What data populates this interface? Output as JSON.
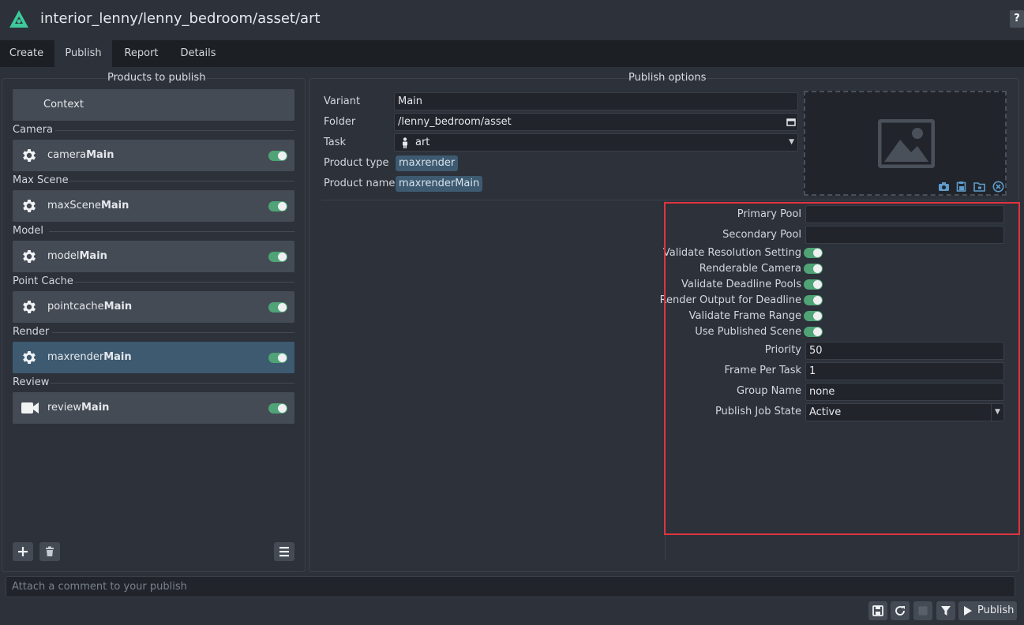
{
  "header": {
    "title": "interior_lenny/lenny_bedroom/asset/art",
    "help_label": "?"
  },
  "tabs": [
    {
      "label": "Create"
    },
    {
      "label": "Publish"
    },
    {
      "label": "Report"
    },
    {
      "label": "Details"
    }
  ],
  "left_panel": {
    "title": "Products to publish",
    "context_label": "Context",
    "groups": [
      {
        "label": "Camera",
        "product_prefix": "camera",
        "product_suffix": "Main",
        "icon": "gear-icon"
      },
      {
        "label": "Max Scene",
        "product_prefix": "maxScene",
        "product_suffix": "Main",
        "icon": "gear-icon"
      },
      {
        "label": "Model",
        "product_prefix": "model",
        "product_suffix": "Main",
        "icon": "gear-icon"
      },
      {
        "label": "Point Cache",
        "product_prefix": "pointcache",
        "product_suffix": "Main",
        "icon": "gear-icon"
      },
      {
        "label": "Render",
        "product_prefix": "maxrender",
        "product_suffix": "Main",
        "icon": "gear-icon",
        "selected": true
      },
      {
        "label": "Review",
        "product_prefix": "review",
        "product_suffix": "Main",
        "icon": "video-camera-icon"
      }
    ]
  },
  "right_panel": {
    "title": "Publish options",
    "variant": {
      "label": "Variant",
      "value": "Main"
    },
    "folder": {
      "label": "Folder",
      "value": "/lenny_bedroom/asset"
    },
    "task": {
      "label": "Task",
      "value": "art"
    },
    "product_type": {
      "label": "Product type",
      "value": "maxrender"
    },
    "product_name": {
      "label": "Product name",
      "value": "maxrenderMain"
    },
    "attributes": {
      "primary_pool": {
        "label": "Primary Pool",
        "value": ""
      },
      "secondary_pool": {
        "label": "Secondary Pool",
        "value": ""
      },
      "toggles": [
        {
          "label": "Validate Resolution Setting",
          "on": true
        },
        {
          "label": "Renderable Camera",
          "on": true
        },
        {
          "label": "Validate Deadline Pools",
          "on": true
        },
        {
          "label": "Render Output for Deadline",
          "on": true
        },
        {
          "label": "Validate Frame Range",
          "on": true
        },
        {
          "label": "Use Published Scene",
          "on": true
        }
      ],
      "priority": {
        "label": "Priority",
        "value": "50"
      },
      "frame_per_task": {
        "label": "Frame Per Task",
        "value": "1"
      },
      "group_name": {
        "label": "Group Name",
        "value": "none"
      },
      "publish_job_state": {
        "label": "Publish Job State",
        "value": "Active"
      }
    }
  },
  "comment": {
    "placeholder": "Attach a comment to your publish"
  },
  "footer": {
    "publish_label": "Publish"
  },
  "colors": {
    "accent": "#3d5a70",
    "toggle_on": "#4fa376",
    "highlight": "#e0343f",
    "logo": "#3ec99a"
  }
}
